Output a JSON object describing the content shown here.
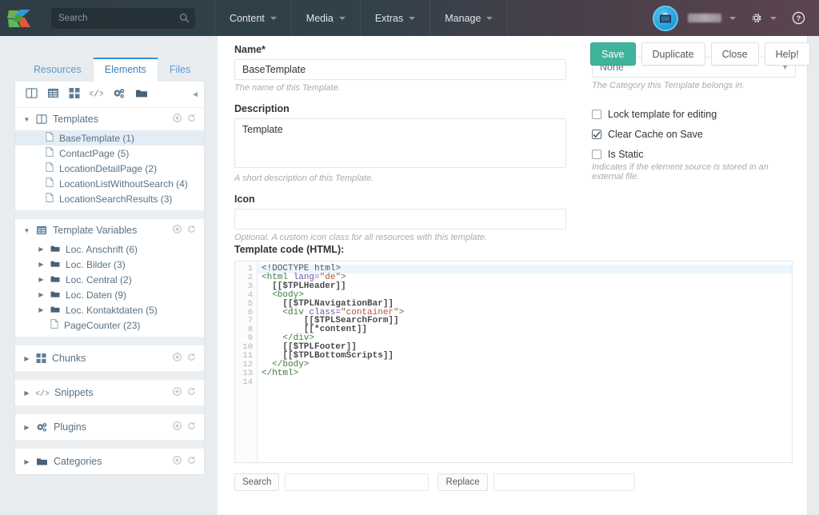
{
  "topbar": {
    "logo_icon": "modx-logo-icon",
    "search": {
      "placeholder": "Search",
      "value": "",
      "icon": "search-icon"
    },
    "menus": [
      {
        "label": "Content"
      },
      {
        "label": "Media"
      },
      {
        "label": "Extras"
      },
      {
        "label": "Manage"
      }
    ],
    "user": {
      "name_redacted": "",
      "avatar_icon": "user-avatar-icon"
    },
    "settings_icon": "gear-icon",
    "help_icon": "question-circle-icon"
  },
  "sidebar": {
    "tabs": [
      {
        "label": "Resources",
        "active": false
      },
      {
        "label": "Elements",
        "active": true
      },
      {
        "label": "Files",
        "active": false
      }
    ],
    "toolbar_icons": [
      "templates-columns-icon",
      "template-variables-list-icon",
      "chunks-grid-icon",
      "snippets-code-icon",
      "plugins-gears-icon",
      "categories-folder-icon"
    ],
    "collapse_icon": "chevron-left-icon",
    "groups": [
      {
        "label": "Templates",
        "icon": "templates-columns-icon",
        "expanded": true,
        "actions": [
          "add-icon",
          "refresh-icon"
        ],
        "items": [
          {
            "label": "BaseTemplate (1)",
            "icon": "file-icon",
            "selected": true
          },
          {
            "label": "ContactPage (5)",
            "icon": "file-icon",
            "selected": false
          },
          {
            "label": "LocationDetailPage (2)",
            "icon": "file-icon",
            "selected": false
          },
          {
            "label": "LocationListWithoutSearch (4)",
            "icon": "file-icon",
            "selected": false
          },
          {
            "label": "LocationSearchResults (3)",
            "icon": "file-icon",
            "selected": false
          }
        ]
      },
      {
        "label": "Template Variables",
        "icon": "template-variables-list-icon",
        "expanded": true,
        "actions": [
          "add-icon",
          "refresh-icon"
        ],
        "items": [
          {
            "label": "Loc. Anschrift (6)",
            "icon": "folder-icon",
            "twisty": true,
            "selected": false
          },
          {
            "label": "Loc. Bilder (3)",
            "icon": "folder-icon",
            "twisty": true,
            "selected": false
          },
          {
            "label": "Loc. Central (2)",
            "icon": "folder-icon",
            "twisty": true,
            "selected": false
          },
          {
            "label": "Loc. Daten (9)",
            "icon": "folder-icon",
            "twisty": true,
            "selected": false
          },
          {
            "label": "Loc. Kontaktdaten (5)",
            "icon": "folder-icon",
            "twisty": true,
            "selected": false
          },
          {
            "label": "PageCounter (23)",
            "icon": "file-icon",
            "twisty": false,
            "selected": false
          }
        ]
      },
      {
        "label": "Chunks",
        "icon": "chunks-grid-icon",
        "expanded": false,
        "actions": [
          "add-icon",
          "refresh-icon"
        ],
        "items": []
      },
      {
        "label": "Snippets",
        "icon": "snippets-code-icon",
        "expanded": false,
        "actions": [
          "add-icon",
          "refresh-icon"
        ],
        "items": []
      },
      {
        "label": "Plugins",
        "icon": "plugins-gears-icon",
        "expanded": false,
        "actions": [
          "add-icon",
          "refresh-icon"
        ],
        "items": []
      },
      {
        "label": "Categories",
        "icon": "categories-folder-icon",
        "expanded": false,
        "actions": [
          "add-icon",
          "refresh-icon"
        ],
        "items": []
      }
    ]
  },
  "form": {
    "name": {
      "label": "Name*",
      "value": "BaseTemplate",
      "placeholder": "",
      "hint": "The name of this Template."
    },
    "description": {
      "label": "Description",
      "value": "Template",
      "placeholder": "",
      "hint": "A short description of this Template."
    },
    "icon": {
      "label": "Icon",
      "value": "",
      "placeholder": "",
      "hint": "Optional. A custom icon class for all resources with this template."
    },
    "category": {
      "value": "None",
      "hint": "The Category this Template belongs in.",
      "chevron_icon": "chevron-down-icon"
    },
    "checkboxes": [
      {
        "label": "Lock template for editing",
        "checked": false
      },
      {
        "label": "Clear Cache on Save",
        "checked": true
      },
      {
        "label": "Is Static",
        "checked": false
      }
    ],
    "is_static_hint": "Indicates if the element source is stored in an external file."
  },
  "actions": [
    {
      "label": "Save",
      "primary": true
    },
    {
      "label": "Duplicate",
      "primary": false
    },
    {
      "label": "Close",
      "primary": false
    },
    {
      "label": "Help!",
      "primary": false
    }
  ],
  "editor": {
    "label": "Template code (HTML):",
    "line_numbers": [
      "1",
      "2",
      "3",
      "4",
      "5",
      "6",
      "7",
      "8",
      "9",
      "10",
      "11",
      "12",
      "13",
      "14"
    ],
    "lines": [
      "<!DOCTYPE html>",
      "<html lang=\"de\">",
      "  [[$TPLHeader]]",
      "  <body>",
      "    [[$TPLNavigationBar]]",
      "    <div class=\"container\">",
      "        [[$TPLSearchForm]]",
      "        [[*content]]",
      "    </div>",
      "    [[$TPLFooter]]",
      "    [[$TPLBottomScripts]]",
      "  </body>",
      "</html>",
      ""
    ],
    "active_line": 1,
    "search_button": "Search",
    "search_value": "",
    "replace_button": "Replace",
    "replace_value": ""
  },
  "colors": {
    "accent_teal": "#3fb39c",
    "link_blue": "#5b9bd5",
    "tab_active_border": "#338fd8",
    "selected_row": "#e4edf5",
    "page_bg": "#e9ecee",
    "topbar_left": "#2f3e46",
    "topbar_right": "#5b4450"
  }
}
